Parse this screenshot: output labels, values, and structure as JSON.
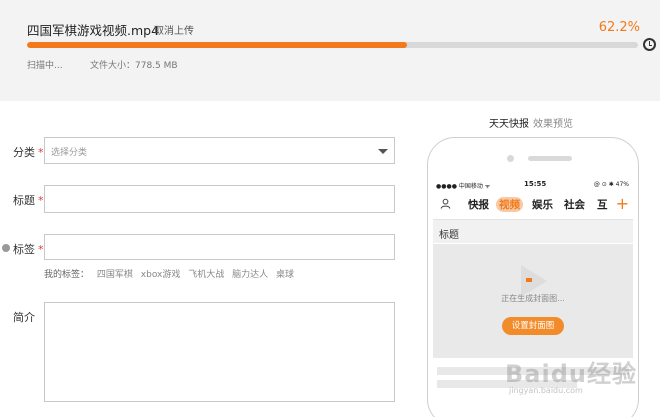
{
  "upload": {
    "file_name": "四国军棋游戏视频.mp4",
    "cancel_label": "取消上传",
    "percent_text": "62.2%",
    "progress": 0.622,
    "status": "扫描中...",
    "file_size": "文件大小：778.5 MB"
  },
  "form": {
    "category": {
      "label": "分类",
      "required": "*",
      "placeholder": "选择分类"
    },
    "title": {
      "label": "标题",
      "required": "*",
      "value": ""
    },
    "tags": {
      "label": "标签",
      "required": "*",
      "value": ""
    },
    "my_tags_label": "我的标签：",
    "my_tags": [
      "四国军棋",
      "xbox游戏",
      "飞机大战",
      "脑力达人",
      "桌球"
    ],
    "intro": {
      "label": "简介",
      "value": ""
    }
  },
  "preview": {
    "title": "天天快报",
    "subtitle": "效果预览",
    "status_bar": {
      "carrier": "●●●● 中国移动 ᯤ",
      "time": "15:55",
      "right": "@ ⊙ ✱ 47%"
    },
    "nav_items": [
      "快报",
      "视频",
      "娱乐",
      "社会",
      "互"
    ],
    "active_nav": "视频",
    "section_label": "标题",
    "generating_text": "正在生成封面图...",
    "set_cover_label": "设置封面图"
  },
  "watermark": {
    "text": "Baidu经验",
    "sub": "jingyan.baidu.com"
  },
  "colors": {
    "accent": "#f27a1a",
    "required": "#e4393c"
  }
}
